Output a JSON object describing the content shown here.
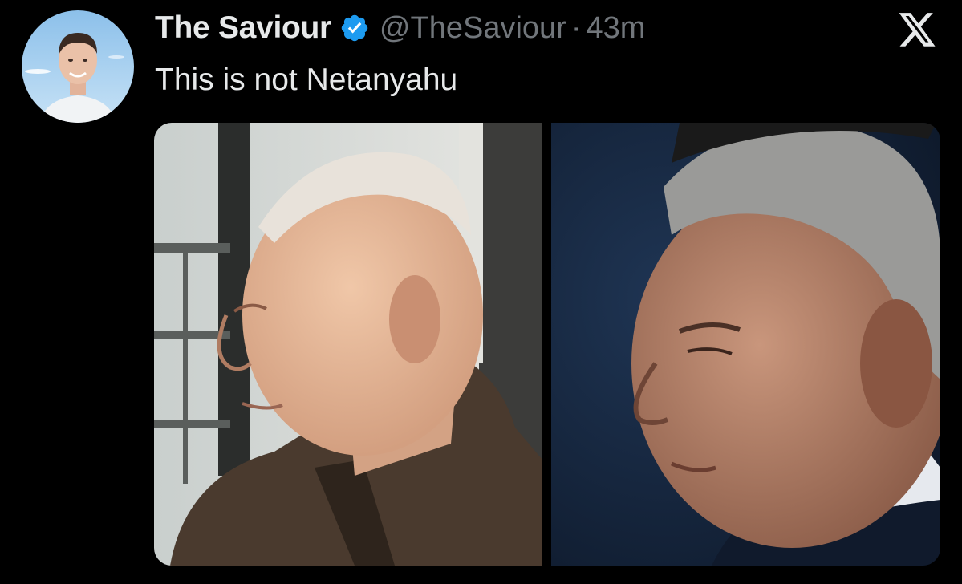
{
  "author": {
    "display_name": "The Saviour",
    "handle": "@TheSaviour",
    "separator": "·",
    "timestamp": "43m",
    "verified": true,
    "avatar_icon": "profile-photo",
    "verified_icon": "verified-badge-icon",
    "verified_color": "#1d9bf0"
  },
  "tweet": {
    "text": "This is not Netanyahu"
  },
  "media": {
    "count": 2,
    "photos": [
      {
        "icon": "man-profile-photo-left"
      },
      {
        "icon": "man-profile-photo-right"
      }
    ]
  },
  "brand": {
    "logo_icon": "x-logo-icon"
  },
  "colors": {
    "background": "#000000",
    "text_primary": "#e7e9ea",
    "text_secondary": "#71767b"
  }
}
